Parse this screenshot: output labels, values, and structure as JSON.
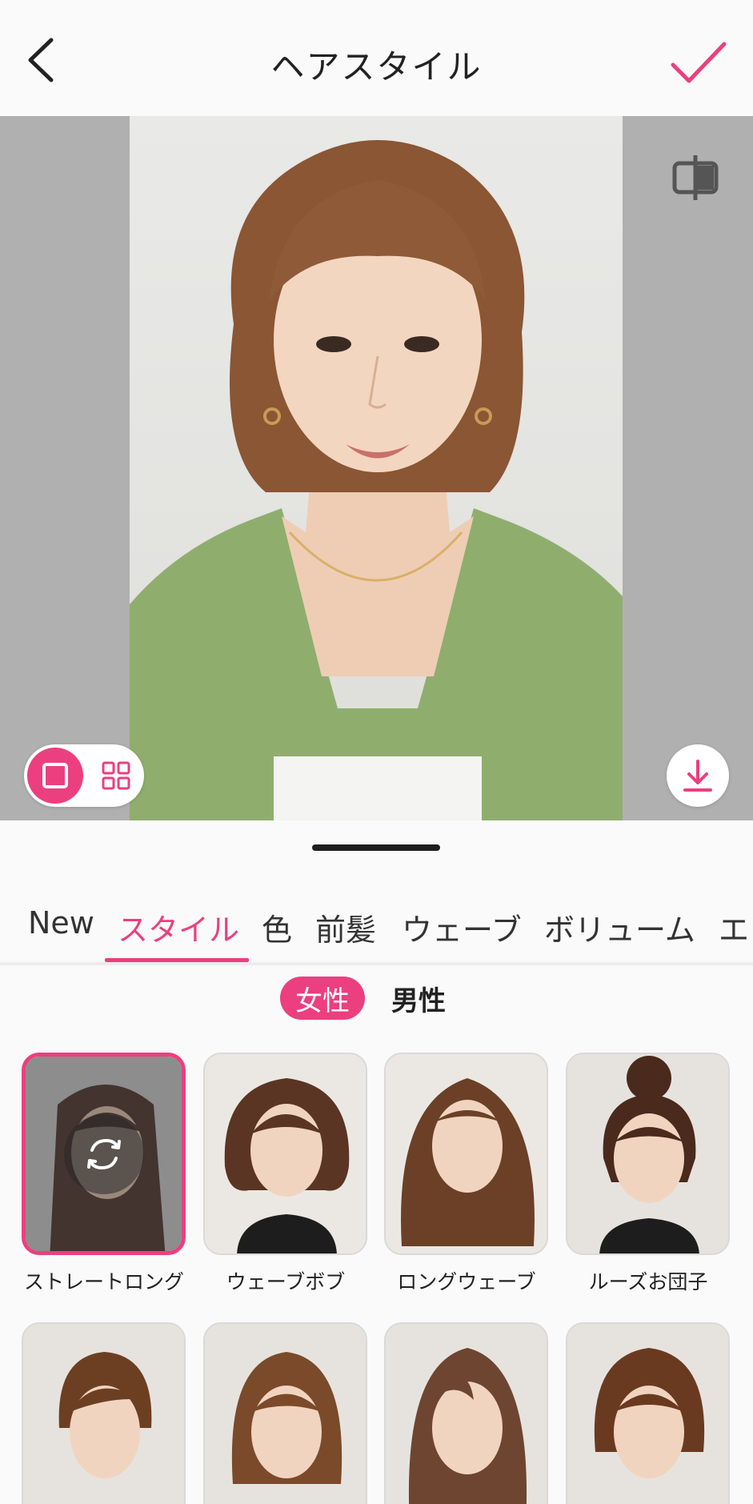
{
  "header": {
    "title": "ヘアスタイル"
  },
  "colors": {
    "accent": "#ec3f7f",
    "photo_bg": "#b0b0b0"
  },
  "icons": {
    "back": "chevron-left-icon",
    "confirm": "check-icon",
    "compare": "compare-icon",
    "single_view": "square-icon",
    "grid_view": "grid-icon",
    "download": "download-icon",
    "refresh": "refresh-icon"
  },
  "tabs": [
    {
      "label": "New",
      "active": false
    },
    {
      "label": "スタイル",
      "active": true
    },
    {
      "label": "色",
      "active": false
    },
    {
      "label": "前髪",
      "active": false
    },
    {
      "label": "ウェーブ",
      "active": false
    },
    {
      "label": "ボリューム",
      "active": false
    },
    {
      "label": "エ",
      "active": false
    }
  ],
  "gender": {
    "female": "女性",
    "male": "男性",
    "selected": "female"
  },
  "styles": [
    {
      "label": "ストレートロング",
      "selected": true
    },
    {
      "label": "ウェーブボブ",
      "selected": false
    },
    {
      "label": "ロングウェーブ",
      "selected": false
    },
    {
      "label": "ルーズお団子",
      "selected": false
    },
    {
      "label": "",
      "selected": false
    },
    {
      "label": "",
      "selected": false
    },
    {
      "label": "",
      "selected": false
    },
    {
      "label": "",
      "selected": false
    }
  ]
}
